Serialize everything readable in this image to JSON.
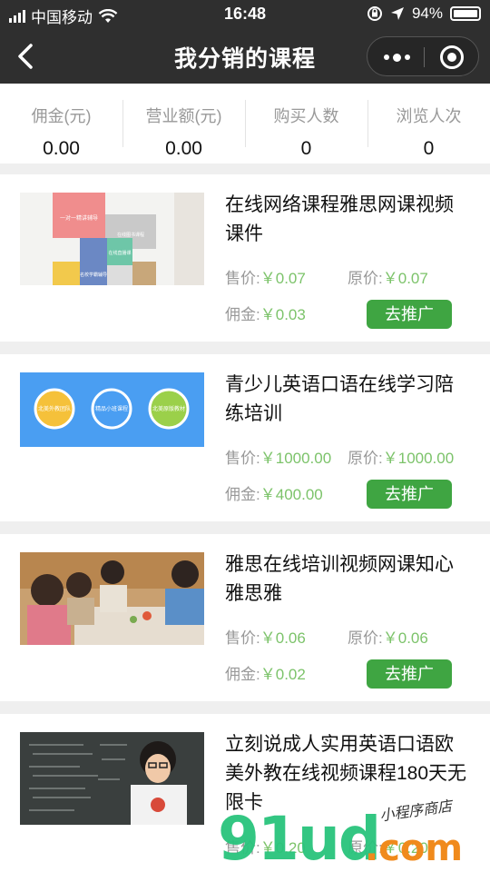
{
  "status_bar": {
    "carrier": "中国移动",
    "time": "16:48",
    "battery_percent": "94%"
  },
  "nav": {
    "title": "我分销的课程"
  },
  "stats": [
    {
      "label": "佣金(元)",
      "value": "0.00"
    },
    {
      "label": "营业额(元)",
      "value": "0.00"
    },
    {
      "label": "购买人数",
      "value": "0"
    },
    {
      "label": "浏览人次",
      "value": "0"
    }
  ],
  "labels": {
    "sale_price": "售价:",
    "original_price": "原价:",
    "commission": "佣金:",
    "promote_button": "去推广"
  },
  "courses": [
    {
      "title": "在线网络课程雅思网课视频课件",
      "sale_price": "￥0.07",
      "original_price": "￥0.07",
      "commission": "￥0.03",
      "thumb_text": [
        "一对一精讲辅导",
        "在线图书课程",
        "名校学霸辅导",
        "在线直播课"
      ]
    },
    {
      "title": "青少儿英语口语在线学习陪练培训",
      "sale_price": "￥1000.00",
      "original_price": "￥1000.00",
      "commission": "￥400.00",
      "thumb_text": [
        "北美外教团队",
        "精品小班课程",
        "北美原版教材"
      ]
    },
    {
      "title": "雅思在线培训视频网课知心雅思雅",
      "sale_price": "￥0.06",
      "original_price": "￥0.06",
      "commission": "￥0.02"
    },
    {
      "title": "立刻说成人实用英语口语欧美外教在线视频课程180天无限卡",
      "sale_price": "￥0.20",
      "original_price": "￥0.20"
    }
  ],
  "watermark": {
    "main": "91ud",
    "domain": ".com",
    "tagline": "小程序商店"
  },
  "colors": {
    "bar_bg": "#2f2f2f",
    "price_green": "#7cc36a",
    "button_green": "#3fa542"
  }
}
